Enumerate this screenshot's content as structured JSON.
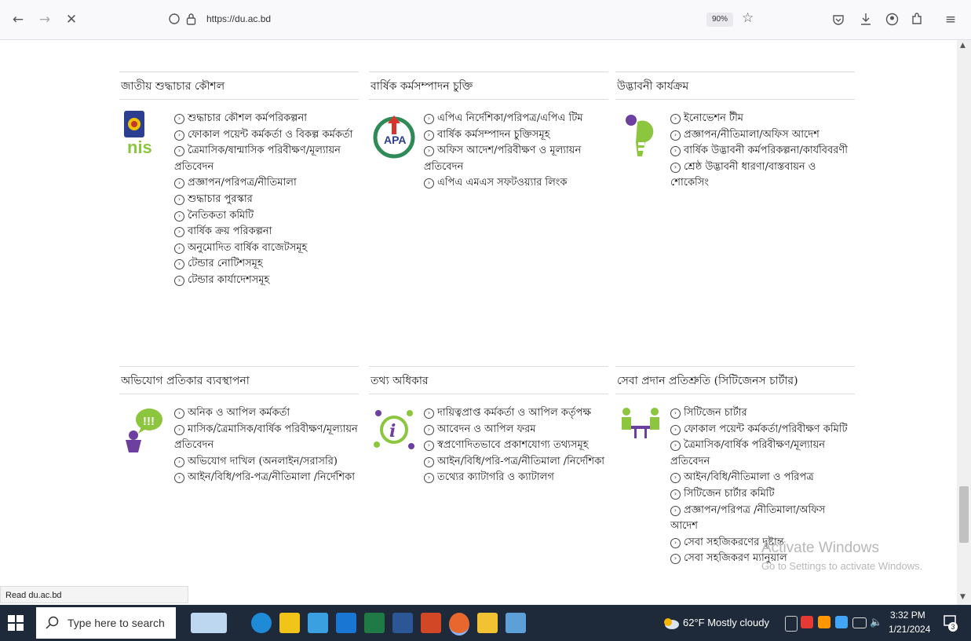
{
  "browser": {
    "url": "https://du.ac.bd",
    "zoom": "90%",
    "status_url": "Read du.ac.bd"
  },
  "sections": [
    {
      "title": "জাতীয় শুদ্ধাচার কৌশল",
      "icon": "nis-logo-icon",
      "links": [
        "শুদ্ধাচার কৌশল কর্মপরিকল্পনা",
        "ফোকাল পয়েন্ট কর্মকর্তা ও বিকল্প কর্মকর্তা",
        "ত্রৈমাসিক/ষান্মাসিক পরিবীক্ষণ/মূল্যায়ন প্রতিবেদন",
        "প্রজ্ঞাপন/পরিপত্র/নীতিমালা",
        "শুদ্ধাচার পুরস্কার",
        "নৈতিকতা কমিটি",
        "বার্ষিক ক্রয় পরিকল্পনা",
        "অনুমোদিত বার্ষিক বাজেটসমূহ",
        "টেন্ডার নোটিশসমূহ",
        "টেন্ডার কার্যাদেশসমূহ"
      ]
    },
    {
      "title": "বার্ষিক কর্মসম্পাদন চুক্তি",
      "icon": "apa-logo-icon",
      "links": [
        "এপিএ নির্দেশিকা/পরিপত্র/এপিএ টিম",
        "বার্ষিক কর্মসম্পাদন চুক্তিসমূহ",
        "অফিস আদেশ/পরিবীক্ষণ ও মূল্যায়ন প্রতিবেদন",
        "এপিএ এমএস সফটওয়্যার লিংক"
      ]
    },
    {
      "title": "উদ্ভাবনী কার্যক্রম",
      "icon": "innovation-bulb-icon",
      "links": [
        "ইনোভেশন টীম",
        "প্রজ্ঞাপন/নীতিমালা/অফিস আদেশ",
        "বার্ষিক উদ্ভাবনী কর্মপরিকল্পনা/কার্যবিবরণী",
        "শ্রেষ্ঠ উদ্ভাবনী ধারণা/বাস্তবায়ন ও শোকেসিং"
      ]
    },
    {
      "title": "অভিযোগ প্রতিকার ব্যবস্থাপনা",
      "icon": "grievance-speech-icon",
      "links": [
        "অনিক ও আপিল কর্মকর্তা",
        "মাসিক/ত্রৈমাসিক/বার্ষিক পরিবীক্ষণ/মূল্যায়ন প্রতিবেদন",
        "অভিযোগ দাখিল (অনলাইন/সরাসরি)",
        "আইন/বিধি/পরি-পত্র/নীতিমালা /নির্দেশিকা"
      ]
    },
    {
      "title": "তথ্য অধিকার",
      "icon": "information-icon",
      "links": [
        "দায়িত্বপ্রাপ্ত কর্মকর্তা ও আপিল কর্তৃপক্ষ",
        "আবেদন ও আপিল ফরম",
        "স্বপ্রণোদিতভাবে প্রকাশযোগ্য তথ্যসমূহ",
        "আইন/বিধি/পরি-পত্র/নীতিমালা /নির্দেশিকা",
        "তথ্যের ক্যাটাগরি ও ক্যাটালগ"
      ]
    },
    {
      "title": "সেবা প্রদান প্রতিশ্রুতি (সিটিজেনস চার্টার)",
      "icon": "citizen-charter-icon",
      "links": [
        "সিটিজেন চার্টার",
        "ফোকাল পয়েন্ট কর্মকর্তা/পরিবীক্ষণ কমিটি",
        "ত্রৈমাসিক/বার্ষিক পরিবীক্ষণ/মূল্যায়ন প্রতিবেদন",
        "আইন/বিধি/নীতিমালা ও পরিপত্র",
        "সিটিজেন চার্টার কমিটি",
        "প্রজ্ঞাপন/পরিপত্র /নীতিমালা/অফিস আদেশ",
        "সেবা সহজিকরণের দৃষ্টান্ত",
        "সেবা সহজিকরণ ম্যানুয়াল"
      ]
    }
  ],
  "watermark": {
    "line1": "Activate Windows",
    "line2": "Go to Settings to activate Windows."
  },
  "taskbar": {
    "search_placeholder": "Type here to search",
    "weather": "62°F  Mostly cloudy",
    "time": "3:32 PM",
    "date": "1/21/2024",
    "notification_count": "3"
  }
}
